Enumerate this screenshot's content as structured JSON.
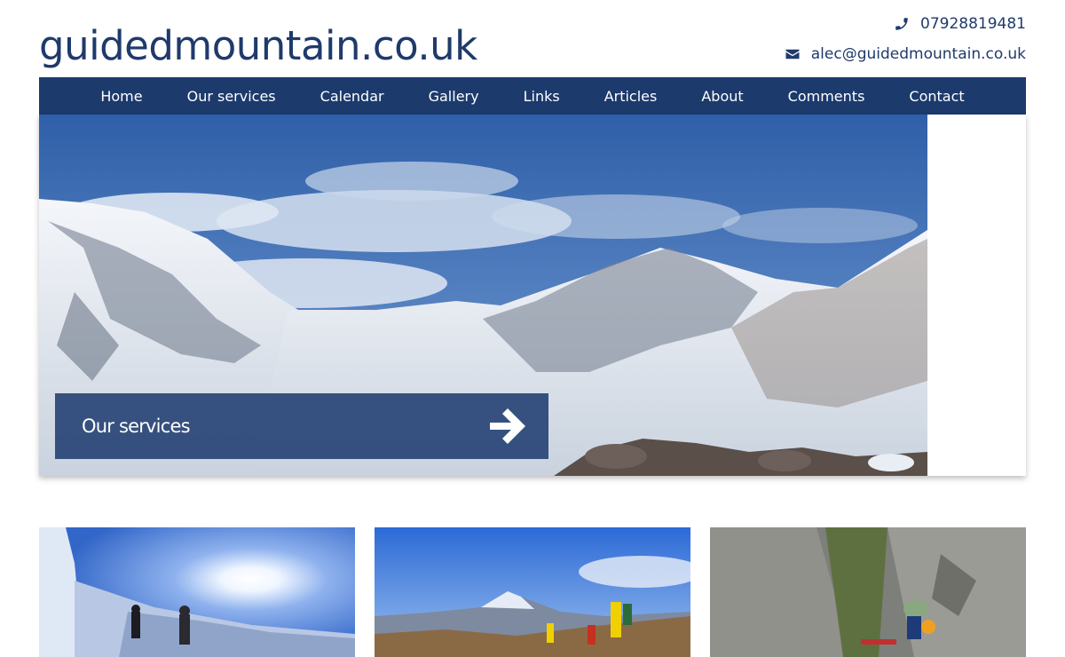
{
  "site": {
    "logo_text": "guidedmountain.co.uk",
    "phone": "07928819481",
    "email": "alec@guidedmountain.co.uk"
  },
  "nav": {
    "items": [
      {
        "label": "Home"
      },
      {
        "label": "Our services"
      },
      {
        "label": "Calendar"
      },
      {
        "label": "Gallery"
      },
      {
        "label": "Links"
      },
      {
        "label": "Articles"
      },
      {
        "label": "About"
      },
      {
        "label": "Comments"
      },
      {
        "label": "Contact"
      }
    ]
  },
  "hero": {
    "banner_label": "Our services",
    "image_subject": "snow-covered-mountain-corrie"
  },
  "thumbnails": [
    {
      "image_subject": "winter-walkers-on-snowy-ridge-with-sun"
    },
    {
      "image_subject": "hikers-walking-toward-snowy-peak"
    },
    {
      "image_subject": "climbers-on-rock-face"
    }
  ],
  "colors": {
    "brand_navy": "#1c3a6c",
    "text_navy": "#1f3a6b",
    "banner_bg": "#284476"
  }
}
